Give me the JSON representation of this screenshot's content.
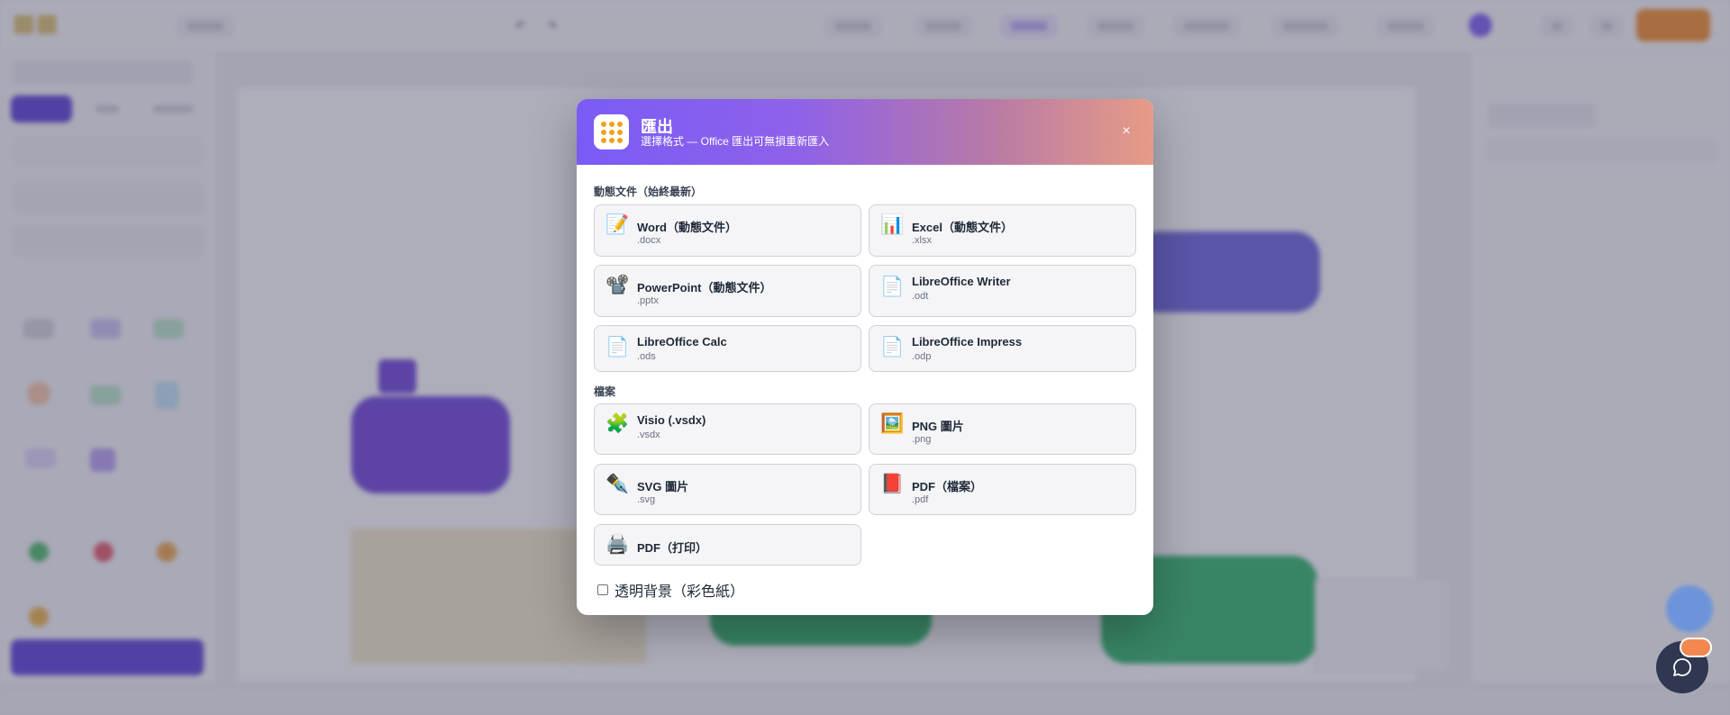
{
  "dialog": {
    "title": "匯出",
    "subtitle": "選擇格式 — Office 匯出可無損重新匯入",
    "close_label": "×",
    "sections": [
      {
        "title": "動態文件（始終最新）",
        "options": [
          {
            "icon": "📝",
            "icon_name": "word-doc-icon",
            "label": "Word（動態文件）",
            "ext": ".docx"
          },
          {
            "icon": "📊",
            "icon_name": "excel-chart-icon",
            "label": "Excel（動態文件）",
            "ext": ".xlsx"
          },
          {
            "icon": "📽️",
            "icon_name": "projector-icon",
            "label": "PowerPoint（動態文件）",
            "ext": ".pptx"
          },
          {
            "icon": "📄",
            "icon_name": "document-icon",
            "label": "LibreOffice Writer",
            "ext": ".odt"
          },
          {
            "icon": "📄",
            "icon_name": "document-icon",
            "label": "LibreOffice Calc",
            "ext": ".ods"
          },
          {
            "icon": "📄",
            "icon_name": "document-icon",
            "label": "LibreOffice Impress",
            "ext": ".odp"
          }
        ]
      },
      {
        "title": "檔案",
        "options": [
          {
            "icon": "🧩",
            "icon_name": "puzzle-icon",
            "label": "Visio (.vsdx)",
            "ext": ".vsdx"
          },
          {
            "icon": "🖼️",
            "icon_name": "image-icon",
            "label": "PNG 圖片",
            "ext": ".png"
          },
          {
            "icon": "✒️",
            "icon_name": "pen-nib-icon",
            "label": "SVG 圖片",
            "ext": ".svg"
          },
          {
            "icon": "📕",
            "icon_name": "pdf-book-icon",
            "label": "PDF（檔案）",
            "ext": ".pdf"
          },
          {
            "icon": "🖨️",
            "icon_name": "printer-icon",
            "label": "PDF（打印）",
            "ext": ""
          }
        ]
      }
    ],
    "transparent_background": {
      "label": "透明背景（彩色紙）",
      "checked": false
    }
  },
  "colors": {
    "header_gradient_start": "#7a5cf5",
    "header_gradient_end": "#e69c86",
    "icon_dots": "#f0a21f",
    "chat_badge": "#f3884f",
    "chat_button": "#2f3850"
  }
}
